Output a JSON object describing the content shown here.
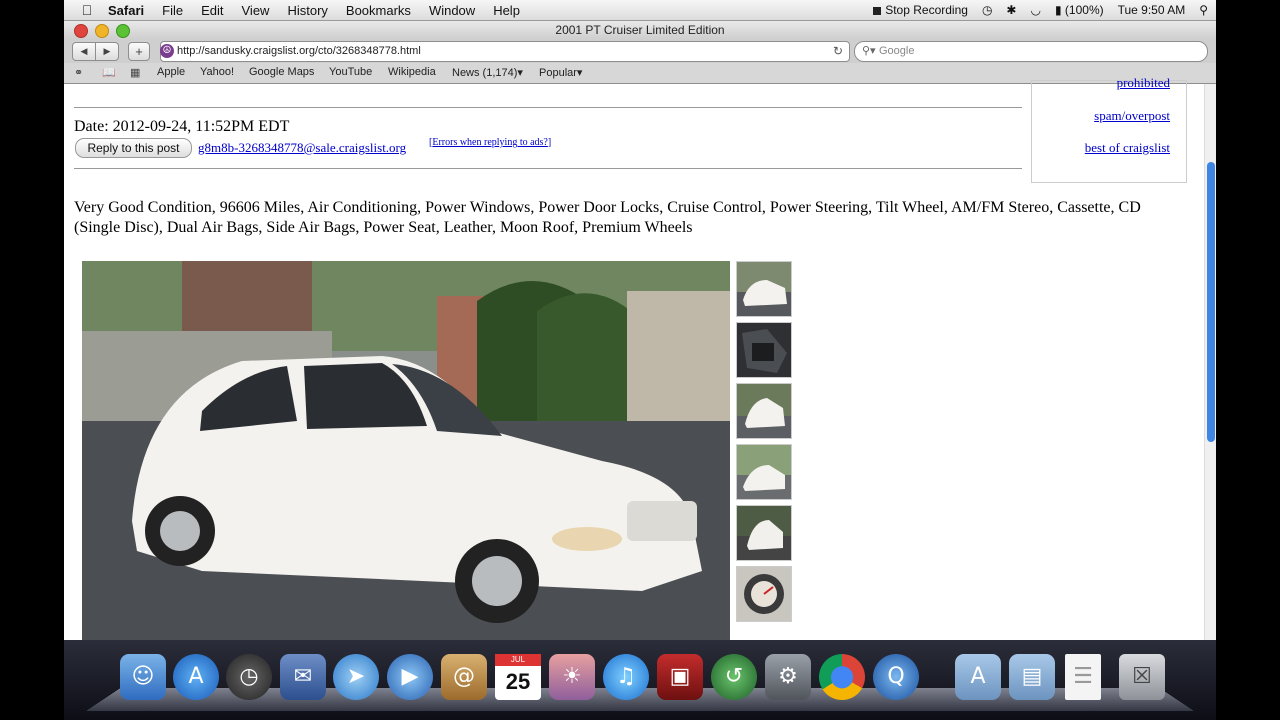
{
  "menubar": {
    "app": "Safari",
    "items": [
      "File",
      "Edit",
      "View",
      "History",
      "Bookmarks",
      "Window",
      "Help"
    ],
    "status": {
      "recording": "Stop Recording",
      "battery": "(100%)",
      "clock": "Tue 9:50 AM"
    }
  },
  "window": {
    "title": "2001 PT Cruiser Limited Edition"
  },
  "toolbar": {
    "url": "http://sandusky.craigslist.org/cto/3268348778.html",
    "search_placeholder": "Google"
  },
  "bookmarks": [
    "Apple",
    "Yahoo!",
    "Google Maps",
    "YouTube",
    "Wikipedia",
    "News (1,174)▾",
    "Popular▾"
  ],
  "sidebar": {
    "links": [
      "prohibited",
      "spam/overpost",
      "best of craigslist"
    ]
  },
  "post": {
    "date": "Date: 2012-09-24, 11:52PM EDT",
    "reply_button": "Reply to this post",
    "email": "g8m8b-3268348778@sale.craigslist.org",
    "errors_open": "[",
    "errors_link": "Errors when replying to ads?",
    "errors_close": "]",
    "description": "Very Good Condition, 96606 Miles, Air Conditioning, Power Windows, Power Door Locks, Cruise Control, Power Steering, Tilt Wheel, AM/FM Stereo, Cassette, CD (Single Disc), Dual Air Bags, Side Air Bags, Power Seat, Leather, Moon Roof, Premium Wheels"
  },
  "dock": {
    "calendar_month": "JUL",
    "calendar_day": "25"
  },
  "colors": {
    "link": "#0000cc",
    "scroll_knob": "#3f86e4"
  }
}
